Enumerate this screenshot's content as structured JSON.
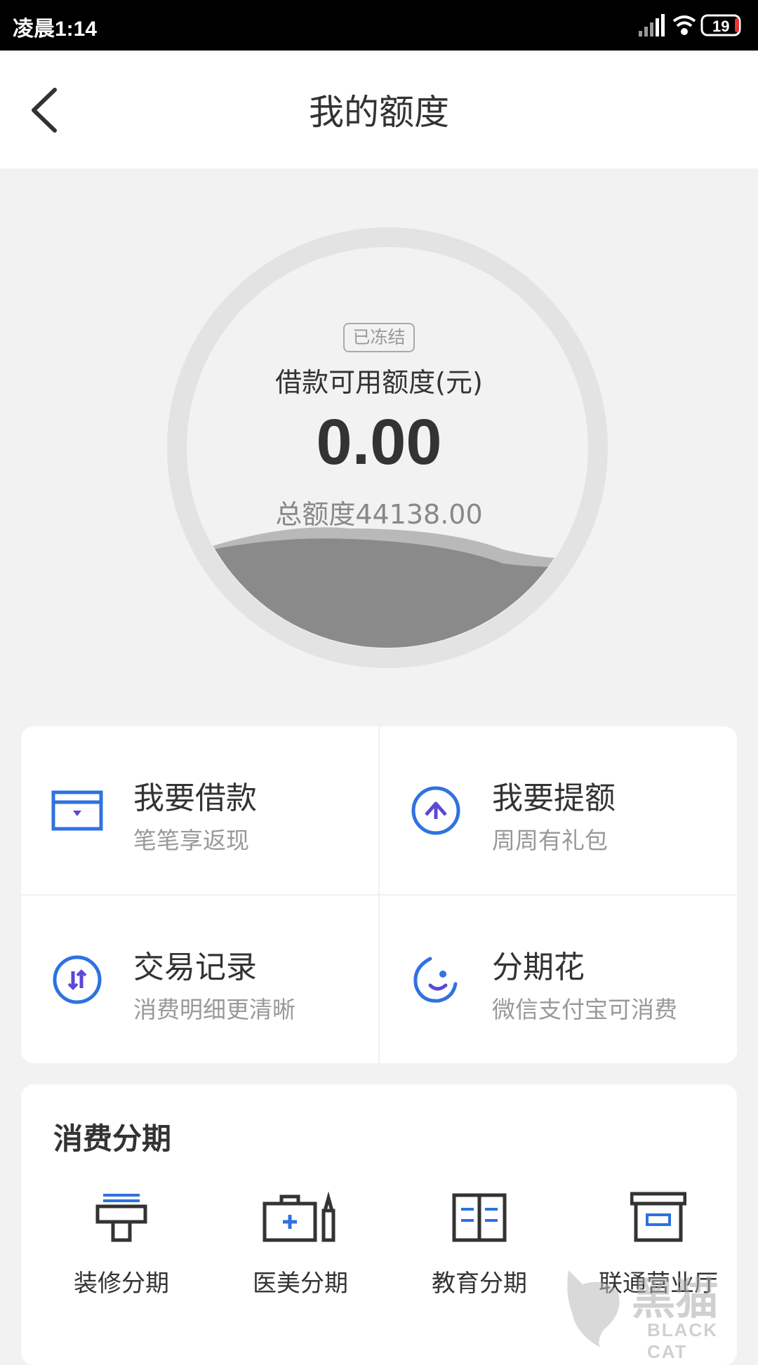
{
  "status_bar": {
    "time": "凌晨1:14",
    "battery": "19",
    "icons": [
      "signal-icon",
      "wifi-icon",
      "battery-icon"
    ]
  },
  "header": {
    "title": "我的额度",
    "back_icon": "chevron-left-icon"
  },
  "credit": {
    "status_badge": "已冻结",
    "available_label": "借款可用额度(元)",
    "available_value": "0.00",
    "total_limit": "总额度44138.00"
  },
  "actions": [
    {
      "title": "我要借款",
      "subtitle": "笔笔享返现",
      "icon": "wallet-card-icon"
    },
    {
      "title": "我要提额",
      "subtitle": "周周有礼包",
      "icon": "raise-limit-icon"
    },
    {
      "title": "交易记录",
      "subtitle": "消费明细更清晰",
      "icon": "transfer-arrows-icon"
    },
    {
      "title": "分期花",
      "subtitle": "微信支付宝可消费",
      "icon": "smile-moon-icon"
    }
  ],
  "installments": {
    "title": "消费分期",
    "items": [
      {
        "label": "装修分期",
        "icon": "paint-roller-icon"
      },
      {
        "label": "医美分期",
        "icon": "medical-kit-icon"
      },
      {
        "label": "教育分期",
        "icon": "book-icon"
      },
      {
        "label": "联通营业厅",
        "icon": "store-box-icon"
      }
    ]
  },
  "watermark": {
    "chinese": "黑猫",
    "english": "BLACK CAT"
  },
  "colors": {
    "accent_blue": "#2f72e0",
    "icon_purple": "#5b48d6",
    "text_dark": "#333333",
    "text_grey": "#999999"
  }
}
